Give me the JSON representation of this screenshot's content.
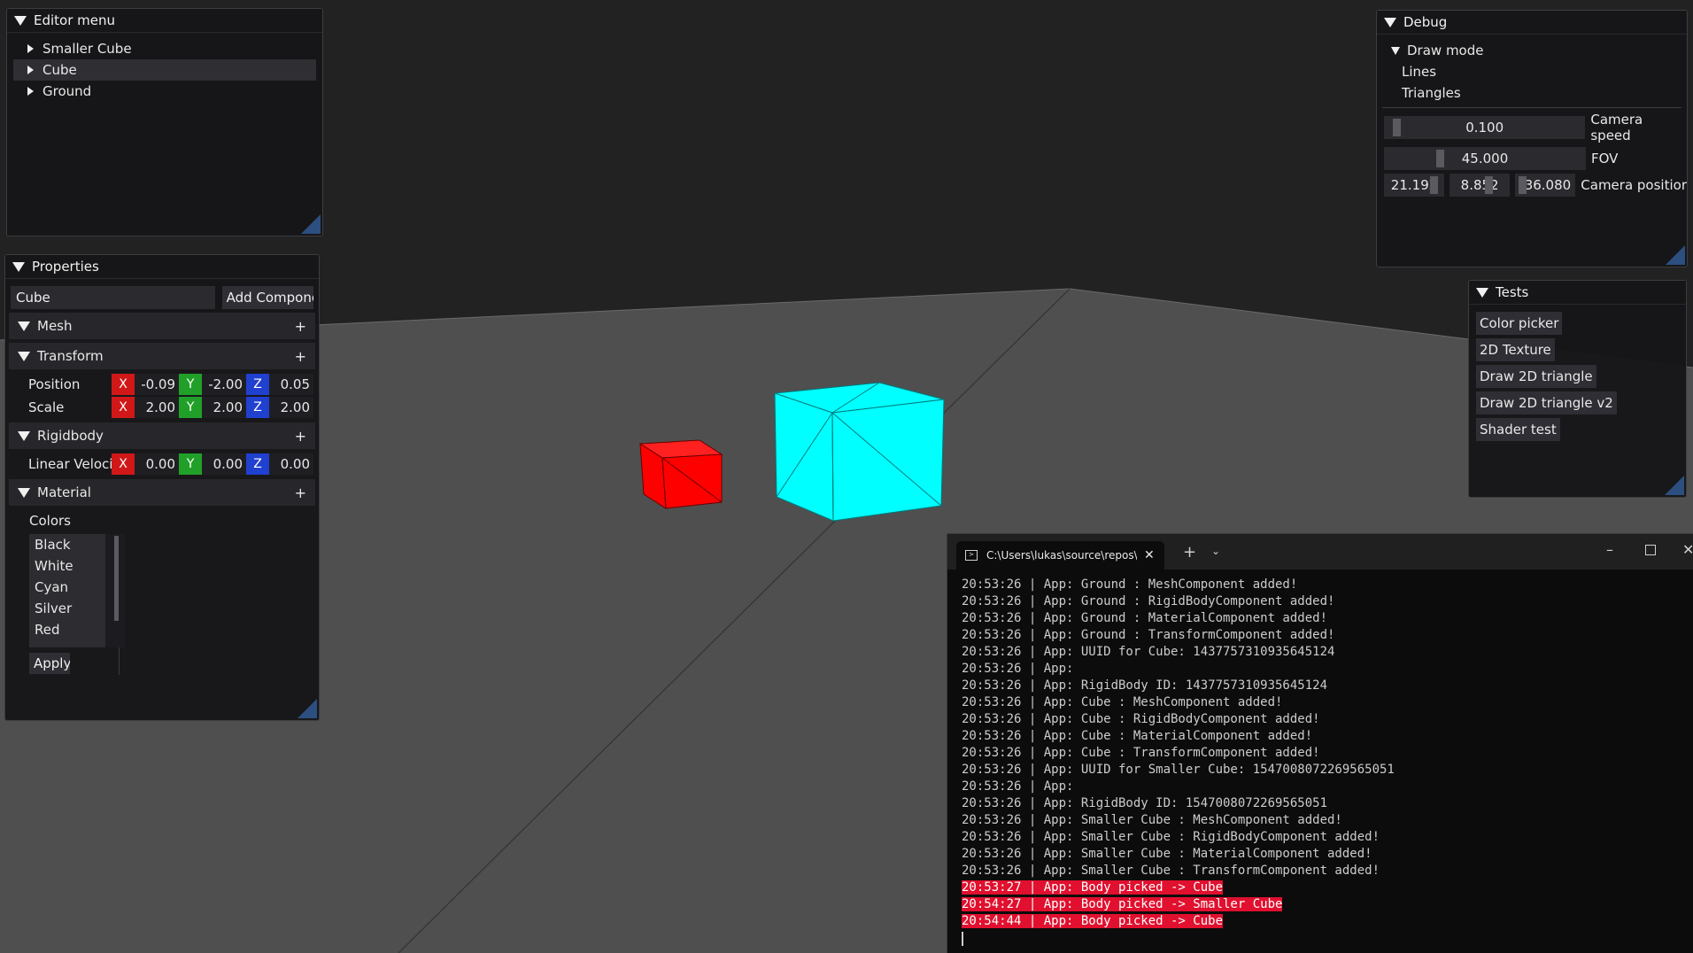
{
  "editor_menu": {
    "title": "Editor menu",
    "items": [
      {
        "label": "Smaller Cube",
        "selected": false
      },
      {
        "label": "Cube",
        "selected": true
      },
      {
        "label": "Ground",
        "selected": false
      }
    ]
  },
  "properties": {
    "title": "Properties",
    "entity_name": "Cube",
    "add_component_label": "Add Componer",
    "mesh": {
      "header": "Mesh",
      "plus": "+"
    },
    "transform": {
      "header": "Transform",
      "plus": "+",
      "position": {
        "label": "Position",
        "x": "-0.09",
        "y": "-2.00",
        "z": "0.05"
      },
      "scale": {
        "label": "Scale",
        "x": "2.00",
        "y": "2.00",
        "z": "2.00"
      }
    },
    "rigidbody": {
      "header": "Rigidbody",
      "plus": "+",
      "linear_velocity": {
        "label": "Linear Velocit",
        "x": "0.00",
        "y": "0.00",
        "z": "0.00"
      }
    },
    "axis_labels": {
      "x": "X",
      "y": "Y",
      "z": "Z"
    },
    "material": {
      "header": "Material",
      "plus": "+",
      "colors_label": "Colors",
      "colors": [
        "Black",
        "White",
        "Cyan",
        "Silver",
        "Red"
      ],
      "apply_label": "Apply"
    }
  },
  "debug": {
    "title": "Debug",
    "draw_mode": {
      "label": "Draw mode",
      "options": [
        "Lines",
        "Triangles"
      ]
    },
    "camera_speed": {
      "value": "0.100",
      "label": "Camera speed",
      "fraction": 0.02
    },
    "fov": {
      "value": "45.000",
      "label": "FOV",
      "fraction": 0.25
    },
    "camera_position": {
      "x": "21.192",
      "y": "8.852",
      "z": "-36.080",
      "label": "Camera positior"
    }
  },
  "tests": {
    "title": "Tests",
    "buttons": [
      "Color picker",
      "2D Texture",
      "Draw 2D triangle",
      "Draw 2D triangle v2",
      "Shader test"
    ]
  },
  "terminal": {
    "tab_title": "C:\\Users\\lukas\\source\\repos\\I",
    "lines": [
      {
        "text": "20:53:26 | App: Ground : MeshComponent added!",
        "highlight": false
      },
      {
        "text": "20:53:26 | App: Ground : RigidBodyComponent added!",
        "highlight": false
      },
      {
        "text": "20:53:26 | App: Ground : MaterialComponent added!",
        "highlight": false
      },
      {
        "text": "20:53:26 | App: Ground : TransformComponent added!",
        "highlight": false
      },
      {
        "text": "20:53:26 | App: UUID for Cube: 1437757310935645124",
        "highlight": false
      },
      {
        "text": "20:53:26 | App:",
        "highlight": false
      },
      {
        "text": "20:53:26 | App: RigidBody ID: 1437757310935645124",
        "highlight": false
      },
      {
        "text": "20:53:26 | App: Cube : MeshComponent added!",
        "highlight": false
      },
      {
        "text": "20:53:26 | App: Cube : RigidBodyComponent added!",
        "highlight": false
      },
      {
        "text": "20:53:26 | App: Cube : MaterialComponent added!",
        "highlight": false
      },
      {
        "text": "20:53:26 | App: Cube : TransformComponent added!",
        "highlight": false
      },
      {
        "text": "20:53:26 | App: UUID for Smaller Cube: 1547008072269565051",
        "highlight": false
      },
      {
        "text": "20:53:26 | App:",
        "highlight": false
      },
      {
        "text": "20:53:26 | App: RigidBody ID: 1547008072269565051",
        "highlight": false
      },
      {
        "text": "20:53:26 | App: Smaller Cube : MeshComponent added!",
        "highlight": false
      },
      {
        "text": "20:53:26 | App: Smaller Cube : RigidBodyComponent added!",
        "highlight": false
      },
      {
        "text": "20:53:26 | App: Smaller Cube : MaterialComponent added!",
        "highlight": false
      },
      {
        "text": "20:53:26 | App: Smaller Cube : TransformComponent added!",
        "highlight": false
      },
      {
        "text": "20:53:27 | App: Body picked -> Cube",
        "highlight": true
      },
      {
        "text": "20:54:27 | App: Body picked -> Smaller Cube",
        "highlight": true
      },
      {
        "text": "20:54:44 | App: Body picked -> Cube",
        "highlight": true
      }
    ]
  },
  "colors": {
    "background": "#222222",
    "ground": "#4f4f4f",
    "cube": "#00ffff",
    "smaller_cube": "#ff0000",
    "highlight": "#e0102e"
  }
}
